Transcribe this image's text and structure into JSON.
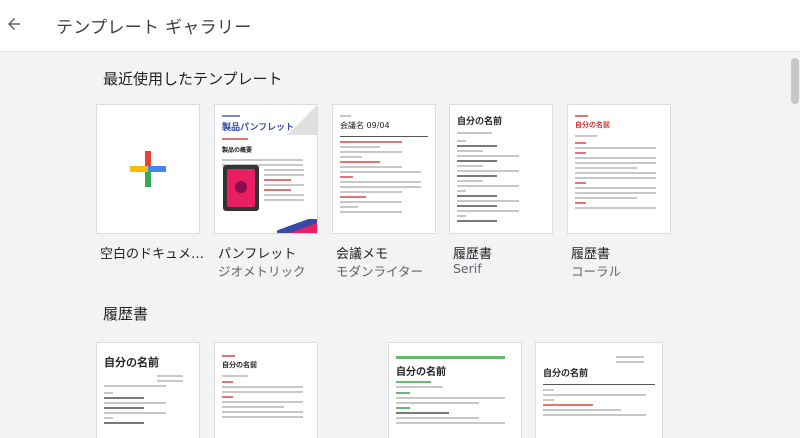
{
  "header": {
    "title": "テンプレート ギャラリー"
  },
  "recent": {
    "title": "最近使用したテンプレート",
    "cards": [
      {
        "name": "空白のドキュメ…",
        "sub": ""
      },
      {
        "name": "パンフレット",
        "sub": "ジオメトリック"
      },
      {
        "name": "会議メモ",
        "sub": "モダンライター"
      },
      {
        "name": "履歴書",
        "sub": "Serif"
      },
      {
        "name": "履歴書",
        "sub": "コーラル"
      }
    ]
  },
  "resume": {
    "title": "履歴書"
  },
  "thumbs": {
    "brochure": {
      "title": "製品パンフレット",
      "heading": "製品の概要"
    },
    "meeting": {
      "title": "会議名 09/04"
    },
    "serif": {
      "title": "自分の名前"
    },
    "coral": {
      "title": "自分の名前"
    },
    "r1": {
      "title": "自分の名前"
    },
    "r2": {
      "title": "自分の名前"
    },
    "r3": {
      "title": "自分の名前"
    },
    "r4": {
      "title": "自分の名前"
    }
  },
  "colors": {
    "accent_red": "#ea4335",
    "accent_yellow": "#fbbc04",
    "accent_green": "#34a853",
    "accent_blue": "#4285f4"
  }
}
